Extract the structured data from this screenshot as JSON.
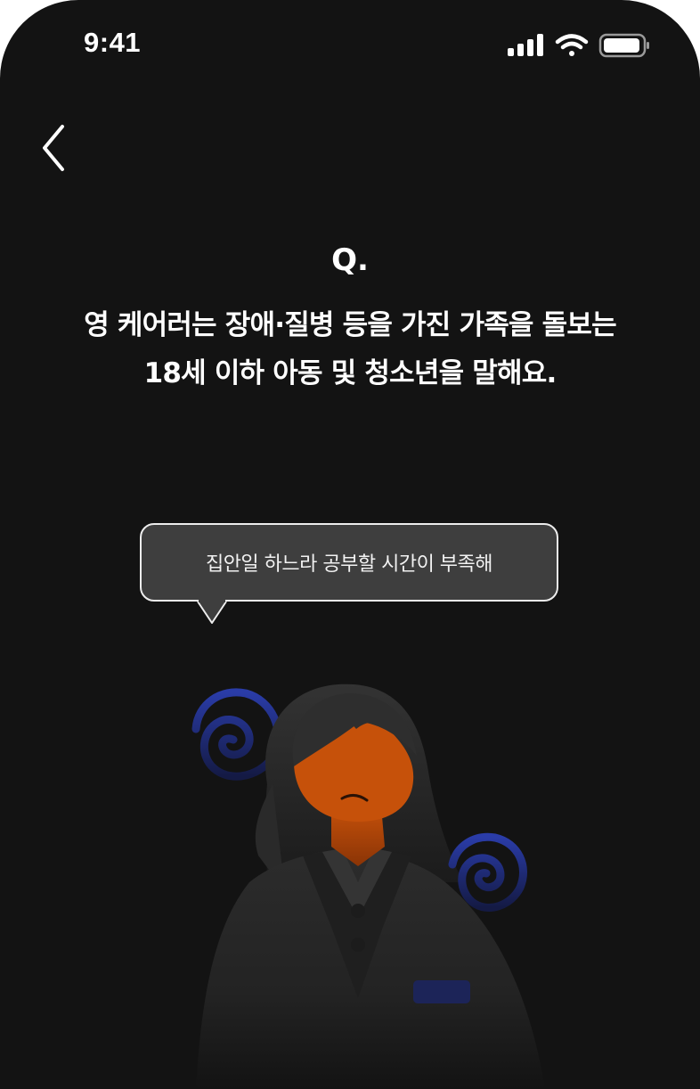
{
  "status_bar": {
    "time": "9:41",
    "signal_icon": "cellular-signal-icon",
    "wifi_icon": "wifi-icon",
    "battery_icon": "battery-icon"
  },
  "nav": {
    "back_icon": "chevron-left-icon"
  },
  "question": {
    "marker": "Q.",
    "lines": [
      "영 케어러는 장애·질병 등을 가진 가족을 돌보는",
      "18세 이하 아동 및 청소년을 말해요."
    ]
  },
  "speech_bubble": {
    "text": "집안일 하느라 공부할 시간이 부족해"
  },
  "illustration": {
    "subject": "worried-student-figure",
    "skin_color": "#c6510a",
    "swirl_color": "#2a3ca8",
    "background_color": "#131313"
  }
}
